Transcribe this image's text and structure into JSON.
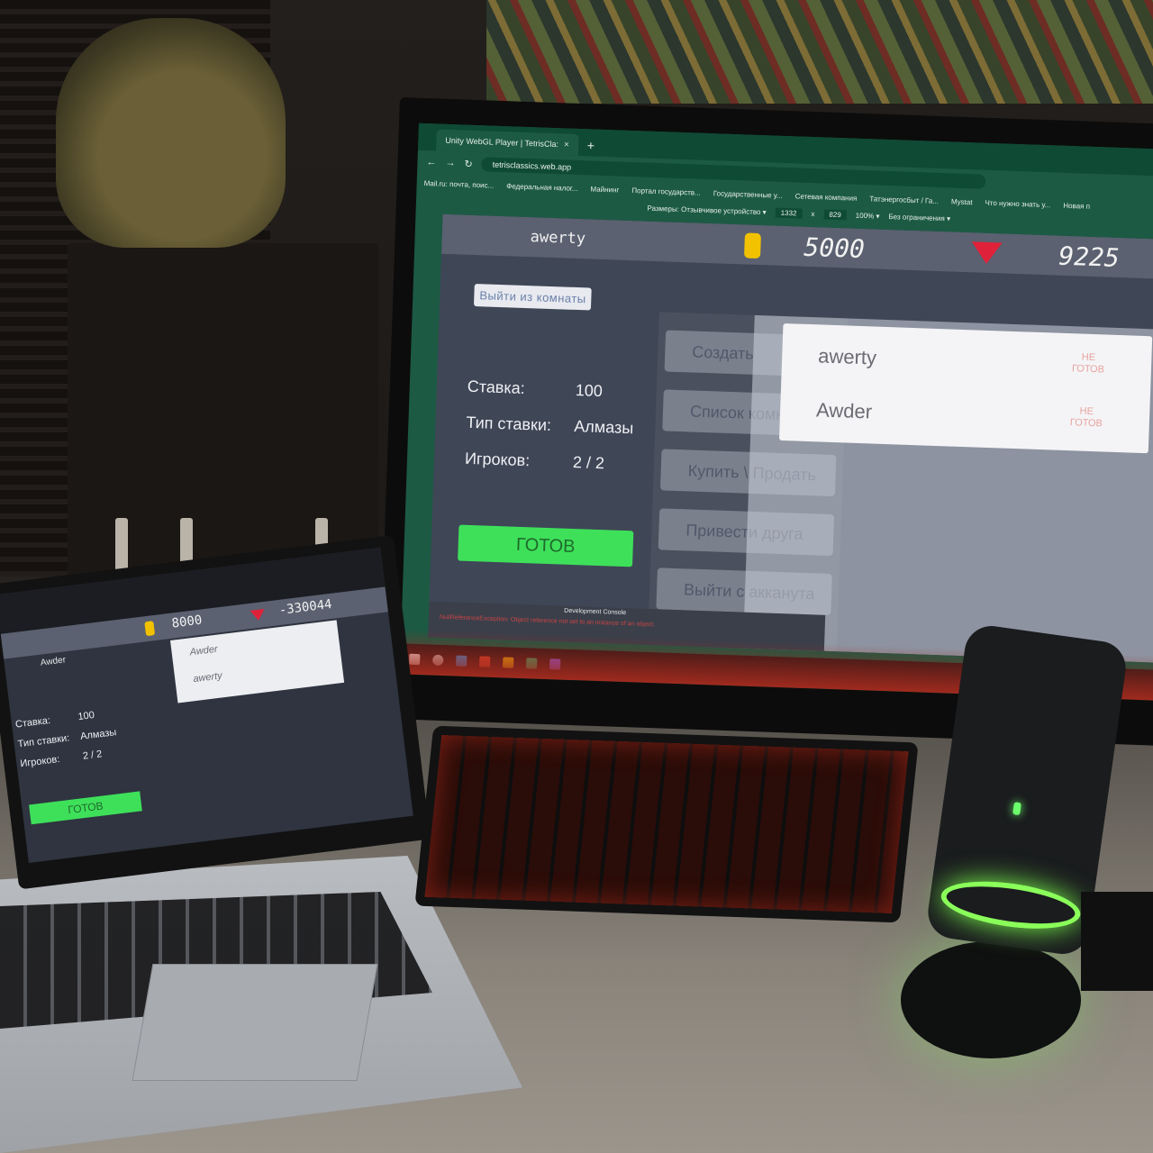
{
  "browser": {
    "tab_title": "Unity WebGL Player | TetrisCla:",
    "tab_close": "×",
    "new_tab": "+",
    "nav_back": "←",
    "nav_forward": "→",
    "nav_reload": "↻",
    "url": "tetrisclassics.web.app",
    "bookmarks": [
      "Mail.ru: почта, поис...",
      "Федеральная налог...",
      "Майнинг",
      "Портал государств...",
      "Государственные у...",
      "Сетевая компания",
      "Татэнергосбыт / Га...",
      "Mystat",
      "Что нужно знать у...",
      "Новая п"
    ],
    "device_toolbar": {
      "dimensions_label": "Размеры: Отзывчивое устройство ▾",
      "width": "1332",
      "times": "x",
      "height": "829",
      "zoom": "100% ▾",
      "throttle": "Без ограничения ▾"
    }
  },
  "game": {
    "player_name": "awerty",
    "coins": "5000",
    "gems": "9225",
    "leave_room": "Выйти из комнаты",
    "bet_label": "Ставка:",
    "bet_value": "100",
    "bet_type_label": "Тип ставки:",
    "bet_type_value": "Алмазы",
    "players_label": "Игроков:",
    "players_value": "2 / 2",
    "ready_button": "ГОТОВ",
    "menu": [
      "Создать",
      "Список комнат",
      "Купить \\ Продать",
      "Привести друга",
      "Выйти с акканута"
    ],
    "room_players": [
      {
        "name": "awerty",
        "status": "НЕ ГОТОВ"
      },
      {
        "name": "Awder",
        "status": "НЕ ГОТОВ"
      }
    ],
    "console_title": "Development Console",
    "console_error": "NullReferenceException: Object reference not set to an instance of an object."
  },
  "laptop": {
    "player_name": "Awder",
    "coins": "8000",
    "gems": "-330044",
    "bet_label": "Ставка:",
    "bet_value": "100",
    "bet_type_label": "Тип ставки:",
    "bet_type_value": "Алмазы",
    "players_label": "Игроков:",
    "players_value": "2 / 2",
    "ready_button": "ГОТОВ",
    "room_players": [
      "Awder",
      "awerty"
    ]
  },
  "colors": {
    "browser_theme": "#1c5a44",
    "ready_green": "#3ee05a",
    "coin_gold": "#f2c200",
    "gem_red": "#e0213a",
    "mic_glow": "#8aff5a",
    "keyboard_glow": "#e63c28"
  }
}
